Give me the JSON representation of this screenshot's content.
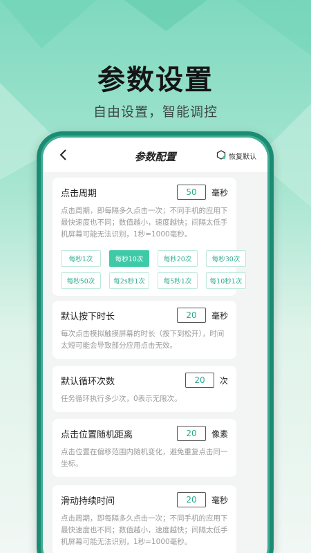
{
  "promo": {
    "headline": "参数设置",
    "subline": "自由设置，智能调控"
  },
  "navbar": {
    "title": "参数配置",
    "restore_label": "恢复默认"
  },
  "settings": [
    {
      "label": "点击周期",
      "value": "50",
      "unit": "毫秒",
      "description": "点击周期，即每隔多久点击一次；不同手机的应用下最快速度也不同；数值越小，速度越快；间隔太低手机屏幕可能无法识别，1秒=1000毫秒。",
      "presets": [
        "每秒1次",
        "每秒10次",
        "每秒20次",
        "每秒30次",
        "每秒50次",
        "每2s秒1次",
        "每5秒1次",
        "每10秒1次"
      ],
      "active_preset": "每秒10次"
    },
    {
      "label": "默认按下时长",
      "value": "20",
      "unit": "毫秒",
      "description": "每次点击模拟触摸屏幕的时长（按下到松开），时间太短可能会导致部分应用点击无效。"
    },
    {
      "label": "默认循环次数",
      "value": "20",
      "unit": "次",
      "description": "任务循环执行多少次，0表示无限次。"
    },
    {
      "label": "点击位置随机距离",
      "value": "20",
      "unit": "像素",
      "description": "点击位置在偏移范围内随机变化，避免重复点击同一坐标。"
    },
    {
      "label": "滑动持续时间",
      "value": "20",
      "unit": "毫秒",
      "description": "点击周期，即每隔多久点击一次；不同手机的应用下最快速度也不同；数值越小，速度越快；间隔太低手机屏幕可能无法识别，1秒=1000毫秒。"
    }
  ],
  "colors": {
    "accent": "#3ec9a7",
    "phone_frame": "#1c8b73",
    "value_text": "#2aa98c"
  }
}
